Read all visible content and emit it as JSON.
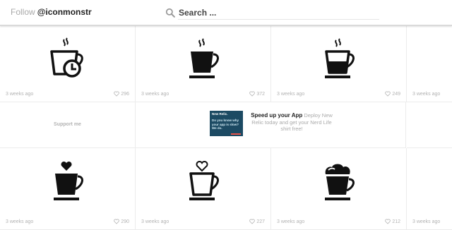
{
  "header": {
    "follow_label": "Follow",
    "handle": "@iconmonstr",
    "search_placeholder": "Search ..."
  },
  "tiles": [
    {
      "icon": "coffee-clock-icon",
      "time": "3 weeks ago",
      "likes": "296"
    },
    {
      "icon": "coffee-steam-icon",
      "time": "3 weeks ago",
      "likes": "372"
    },
    {
      "icon": "coffee-outline-icon",
      "time": "3 weeks ago",
      "likes": "249"
    },
    {
      "icon": "partial",
      "time": "3 weeks ago",
      "likes": ""
    },
    {
      "icon": "coffee-heart-icon",
      "time": "3 weeks ago",
      "likes": "290"
    },
    {
      "icon": "coffee-heart-outline-icon",
      "time": "3 weeks ago",
      "likes": "227"
    },
    {
      "icon": "coffee-cream-icon",
      "time": "3 weeks ago",
      "likes": "212"
    },
    {
      "icon": "partial",
      "time": "3 weeks ago",
      "likes": ""
    }
  ],
  "support": {
    "label": "Support me"
  },
  "ad": {
    "thumb_brand": "New Relic.",
    "thumb_text": "Do you know why your app is slow? We do.",
    "headline": "Speed up your App",
    "body": "Deploy New Relic today and get your Nerd Life shirt free!"
  },
  "colors": {
    "muted": "#b3b3b3",
    "icon": "#111111",
    "ad_bg": "#1c4a63"
  }
}
